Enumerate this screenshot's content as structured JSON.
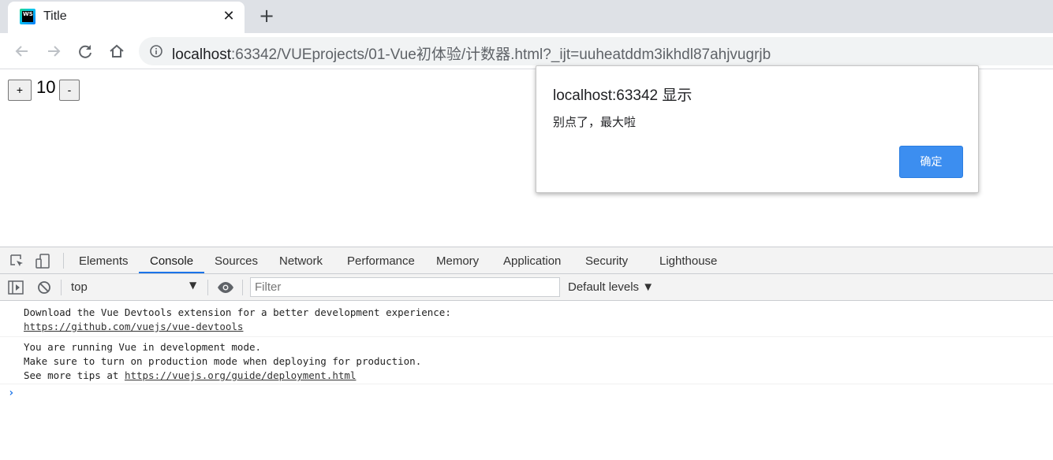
{
  "browser": {
    "tab": {
      "title": "Title",
      "favicon": "webstorm-icon",
      "close_glyph": "✕"
    },
    "new_tab_glyph": "+",
    "url": {
      "host": "localhost",
      "path": ":63342/VUEprojects/01-Vue初体验/计数器.html?_ijt=uuheatddm3ikhdl87ahjvugrjb"
    }
  },
  "page": {
    "plus_label": "+",
    "count": "10",
    "minus_label": "-"
  },
  "alert": {
    "title": "localhost:63342 显示",
    "message": "别点了，最大啦",
    "ok_label": "确定",
    "ok_color": "#3c8ef0"
  },
  "devtools": {
    "tabs": [
      {
        "label": "Elements"
      },
      {
        "label": "Console"
      },
      {
        "label": "Sources"
      },
      {
        "label": "Network"
      },
      {
        "label": "Performance"
      },
      {
        "label": "Memory"
      },
      {
        "label": "Application"
      },
      {
        "label": "Security"
      },
      {
        "label": "Lighthouse"
      }
    ],
    "active_tab": "Console",
    "context": "top",
    "filter_placeholder": "Filter",
    "levels": "Default levels ▼",
    "messages": [
      {
        "line1": "Download the Vue Devtools extension for a better development experience:",
        "link": "https://github.com/vuejs/vue-devtools"
      },
      {
        "line1": "You are running Vue in development mode.",
        "line2": "Make sure to turn on production mode when deploying for production.",
        "line3_prefix": "See more tips at ",
        "link": "https://vuejs.org/guide/deployment.html"
      }
    ],
    "prompt": "›"
  }
}
